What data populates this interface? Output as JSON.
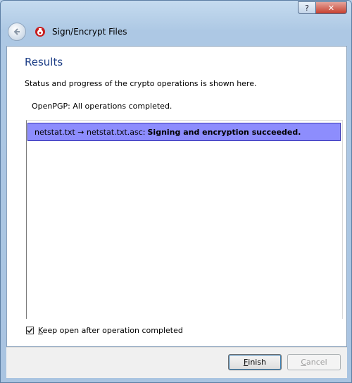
{
  "window": {
    "title": "Sign/Encrypt Files",
    "help_button": "?",
    "close_button": "✕"
  },
  "page": {
    "heading": "Results",
    "description": "Status and progress of the crypto operations is shown here.",
    "status_prefix": "OpenPGP:",
    "status_text": "All operations completed."
  },
  "results": [
    {
      "files": "netstat.txt → netstat.txt.asc:",
      "message": "Signing and encryption succeeded."
    }
  ],
  "options": {
    "keep_open_label": "Keep open after operation completed",
    "keep_open_checked": true
  },
  "buttons": {
    "finish": "Finish",
    "cancel": "Cancel"
  },
  "colors": {
    "row_highlight": "#8d8dfd",
    "heading": "#1e3f87"
  }
}
